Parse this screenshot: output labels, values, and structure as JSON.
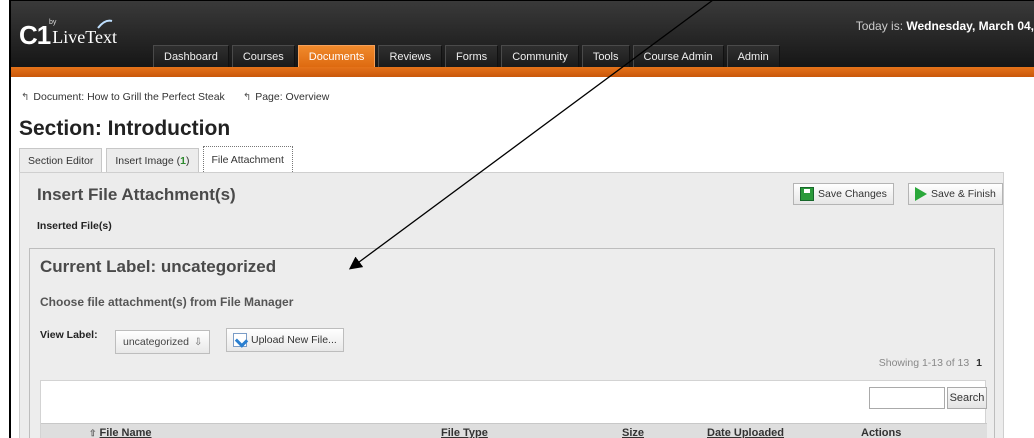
{
  "header": {
    "logo_main": "C1",
    "logo_by": "by",
    "logo_name": "LiveText",
    "today_prefix": "Today is:",
    "today_value": "Wednesday, March 04,"
  },
  "nav": {
    "items": [
      {
        "label": "Dashboard"
      },
      {
        "label": "Courses"
      },
      {
        "label": "Documents"
      },
      {
        "label": "Reviews"
      },
      {
        "label": "Forms"
      },
      {
        "label": "Community"
      },
      {
        "label": "Tools"
      },
      {
        "label": "Course Admin"
      },
      {
        "label": "Admin"
      }
    ],
    "active": "Documents",
    "accent_color": "#e8771c"
  },
  "breadcrumb": {
    "items": [
      {
        "label": "Document: How to Grill the Perfect Steak"
      },
      {
        "label": "Page: Overview"
      }
    ]
  },
  "page": {
    "title": "Section: Introduction"
  },
  "tabs": {
    "section_editor": "Section Editor",
    "insert_image_label": "Insert Image (",
    "insert_image_count": "1",
    "insert_image_close": ")",
    "file_attachment": "File Attachment"
  },
  "panel": {
    "title": "Insert File Attachment(s)",
    "save_changes": "Save Changes",
    "save_finish": "Save & Finish",
    "inserted_files": "Inserted File(s)"
  },
  "label_box": {
    "title": "Current Label:  uncategorized",
    "choose_text": "Choose file attachment(s) from File Manager",
    "view_label": "View Label:",
    "selected_label": "uncategorized",
    "upload_button": "Upload New File...",
    "showing_text": "Showing 1-13 of 13",
    "page_number": "1"
  },
  "table": {
    "search_button": "Search",
    "search_value": "",
    "columns": {
      "file_name": "File Name",
      "file_type": "File Type",
      "size": "Size",
      "date_uploaded": "Date Uploaded",
      "actions": "Actions"
    }
  }
}
